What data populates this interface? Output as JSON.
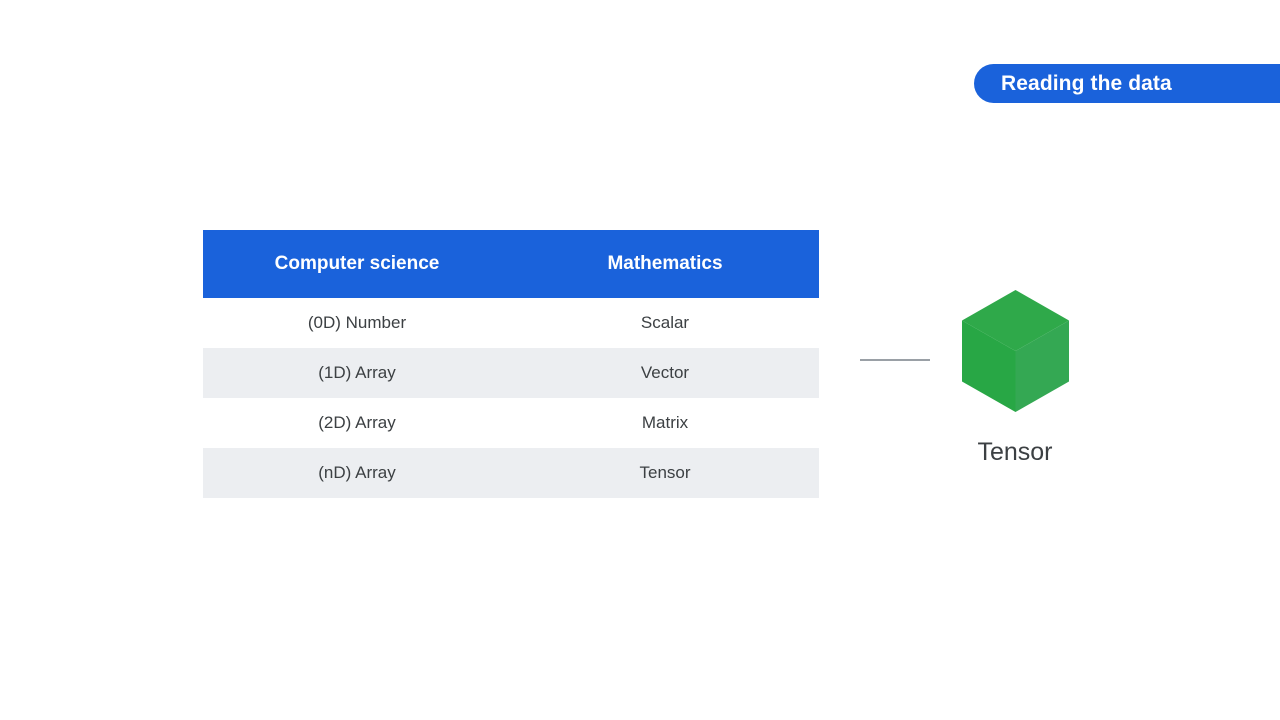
{
  "banner": {
    "title": "Reading the data",
    "background_color": "#1a62db",
    "text_color": "#ffffff"
  },
  "table": {
    "header_background": "#1a62db",
    "header_text_color": "#ffffff",
    "stripe_color": "#eceef1",
    "columns": [
      "Computer science",
      "Mathematics"
    ],
    "rows": [
      {
        "cs": "(0D) Number",
        "math": "Scalar"
      },
      {
        "cs": "(1D) Array",
        "math": "Vector"
      },
      {
        "cs": "(2D) Array",
        "math": "Matrix"
      },
      {
        "cs": "(nD) Array",
        "math": "Tensor"
      }
    ]
  },
  "connector": {
    "color": "#9aa0a6"
  },
  "tensor": {
    "label": "Tensor",
    "icon": "green-cube-icon",
    "colors": {
      "top": "#2fa94a",
      "left": "#28a745",
      "right": "#34a853"
    }
  }
}
